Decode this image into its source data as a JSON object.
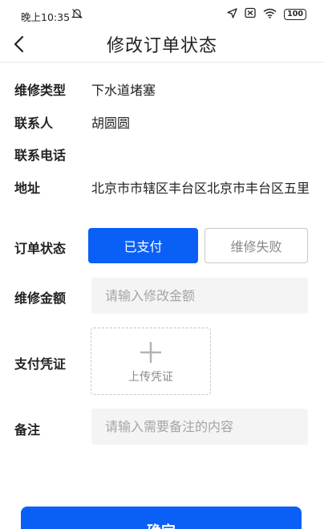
{
  "status_bar": {
    "time": "晚上10:35",
    "battery": "100",
    "icons": [
      "mute-icon",
      "location-arrow-icon",
      "sim-off-icon",
      "wifi-icon",
      "battery-icon"
    ]
  },
  "header": {
    "title": "修改订单状态",
    "back_icon": "chevron-left-icon"
  },
  "info": {
    "repair_type_label": "维修类型",
    "repair_type_value": "下水道堵塞",
    "contact_label": "联系人",
    "contact_value": "胡圆圆",
    "phone_label": "联系电话",
    "phone_value": "",
    "address_label": "地址",
    "address_value": "北京市市辖区丰台区北京市丰台区五里"
  },
  "order_status": {
    "label": "订单状态",
    "options": [
      "已支付",
      "维修失败"
    ],
    "selected": "已支付"
  },
  "amount": {
    "label": "维修金额",
    "placeholder": "请输入修改金额",
    "value": ""
  },
  "voucher": {
    "label": "支付凭证",
    "upload_label": "上传凭证",
    "icon": "plus-icon"
  },
  "remark": {
    "label": "备注",
    "placeholder": "请输入需要备注的内容",
    "value": ""
  },
  "confirm_label": "确定",
  "colors": {
    "primary": "#0a5ff7",
    "input_bg": "#f4f4f4",
    "placeholder": "#a5a5a5",
    "divider": "#eaeaea"
  }
}
